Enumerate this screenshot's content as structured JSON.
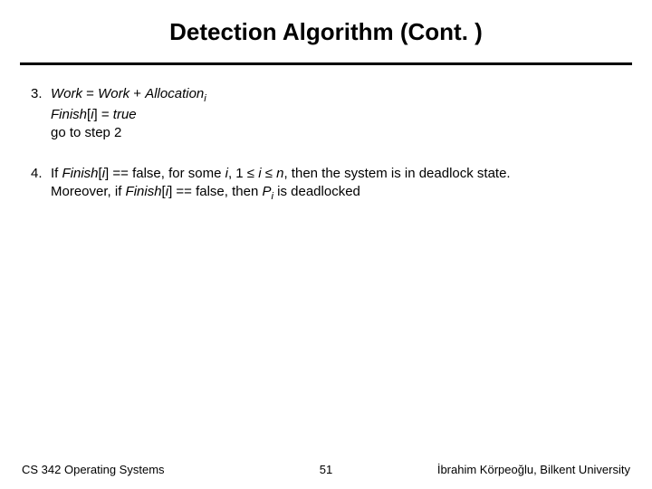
{
  "title": "Detection Algorithm (Cont. )",
  "items": [
    {
      "num": "3.",
      "l1a": "Work",
      "l1b": " = ",
      "l1c": "Work",
      "l1d": " + ",
      "l1e": "Allocation",
      "l1sub": "i",
      "l2a": "Finish",
      "l2b": "[",
      "l2c": "i",
      "l2d": "] = ",
      "l2e": "true",
      "l3": "go to step 2"
    },
    {
      "num": "4.",
      "a1": "If ",
      "a2": "Finish",
      "a3": "[",
      "a4": "i",
      "a5": "] == false, for some ",
      "a6": "i",
      "a7": ", 1 ≤ ",
      "a8": "i",
      "a9": " ≤  ",
      "a10": "n",
      "a11": ", then the system is in deadlock state.",
      "b1": "Moreover, if ",
      "b2": "Finish",
      "b3": "[",
      "b4": "i",
      "b5": "] == false, then ",
      "b6": "P",
      "b6sub": "i",
      "b7": " is deadlocked"
    }
  ],
  "footer": {
    "left": "CS 342 Operating Systems",
    "center": "51",
    "right": "İbrahim Körpeoğlu, Bilkent University"
  }
}
